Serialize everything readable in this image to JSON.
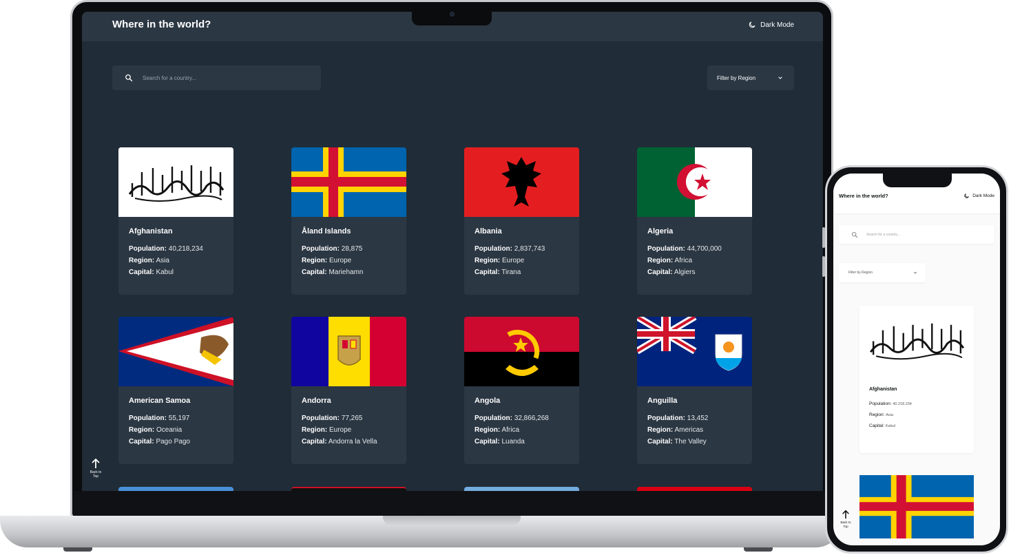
{
  "laptop": {
    "header": {
      "title": "Where in the world?",
      "mode_label": "Dark Mode"
    },
    "search": {
      "placeholder": "Search for a country..."
    },
    "filter": {
      "label": "Filter by Region"
    },
    "labels": {
      "population": "Population:",
      "region": "Region:",
      "capital": "Capital:"
    },
    "countries": [
      {
        "name": "Afghanistan",
        "population": "40,218,234",
        "region": "Asia",
        "capital": "Kabul"
      },
      {
        "name": "Åland Islands",
        "population": "28,875",
        "region": "Europe",
        "capital": "Mariehamn"
      },
      {
        "name": "Albania",
        "population": "2,837,743",
        "region": "Europe",
        "capital": "Tirana"
      },
      {
        "name": "Algeria",
        "population": "44,700,000",
        "region": "Africa",
        "capital": "Algiers"
      },
      {
        "name": "American Samoa",
        "population": "55,197",
        "region": "Oceania",
        "capital": "Pago Pago"
      },
      {
        "name": "Andorra",
        "population": "77,265",
        "region": "Europe",
        "capital": "Andorra la Vella"
      },
      {
        "name": "Angola",
        "population": "32,866,268",
        "region": "Africa",
        "capital": "Luanda"
      },
      {
        "name": "Anguilla",
        "population": "13,452",
        "region": "Americas",
        "capital": "The Valley"
      }
    ],
    "back_to_top": "Back to Top"
  },
  "phone": {
    "header": {
      "title": "Where in the world?",
      "mode_label": "Dark Mode"
    },
    "search": {
      "placeholder": "Search for a country..."
    },
    "filter": {
      "label": "Filter by Region"
    },
    "card": {
      "name": "Afghanistan",
      "population": "40.218.234",
      "region": "Asia",
      "capital": "Kabul"
    },
    "back_to_top": "Back to Top"
  },
  "colors": {
    "dark_bg": "#202c37",
    "dark_element": "#2b3743",
    "light_bg": "#fafafa"
  }
}
